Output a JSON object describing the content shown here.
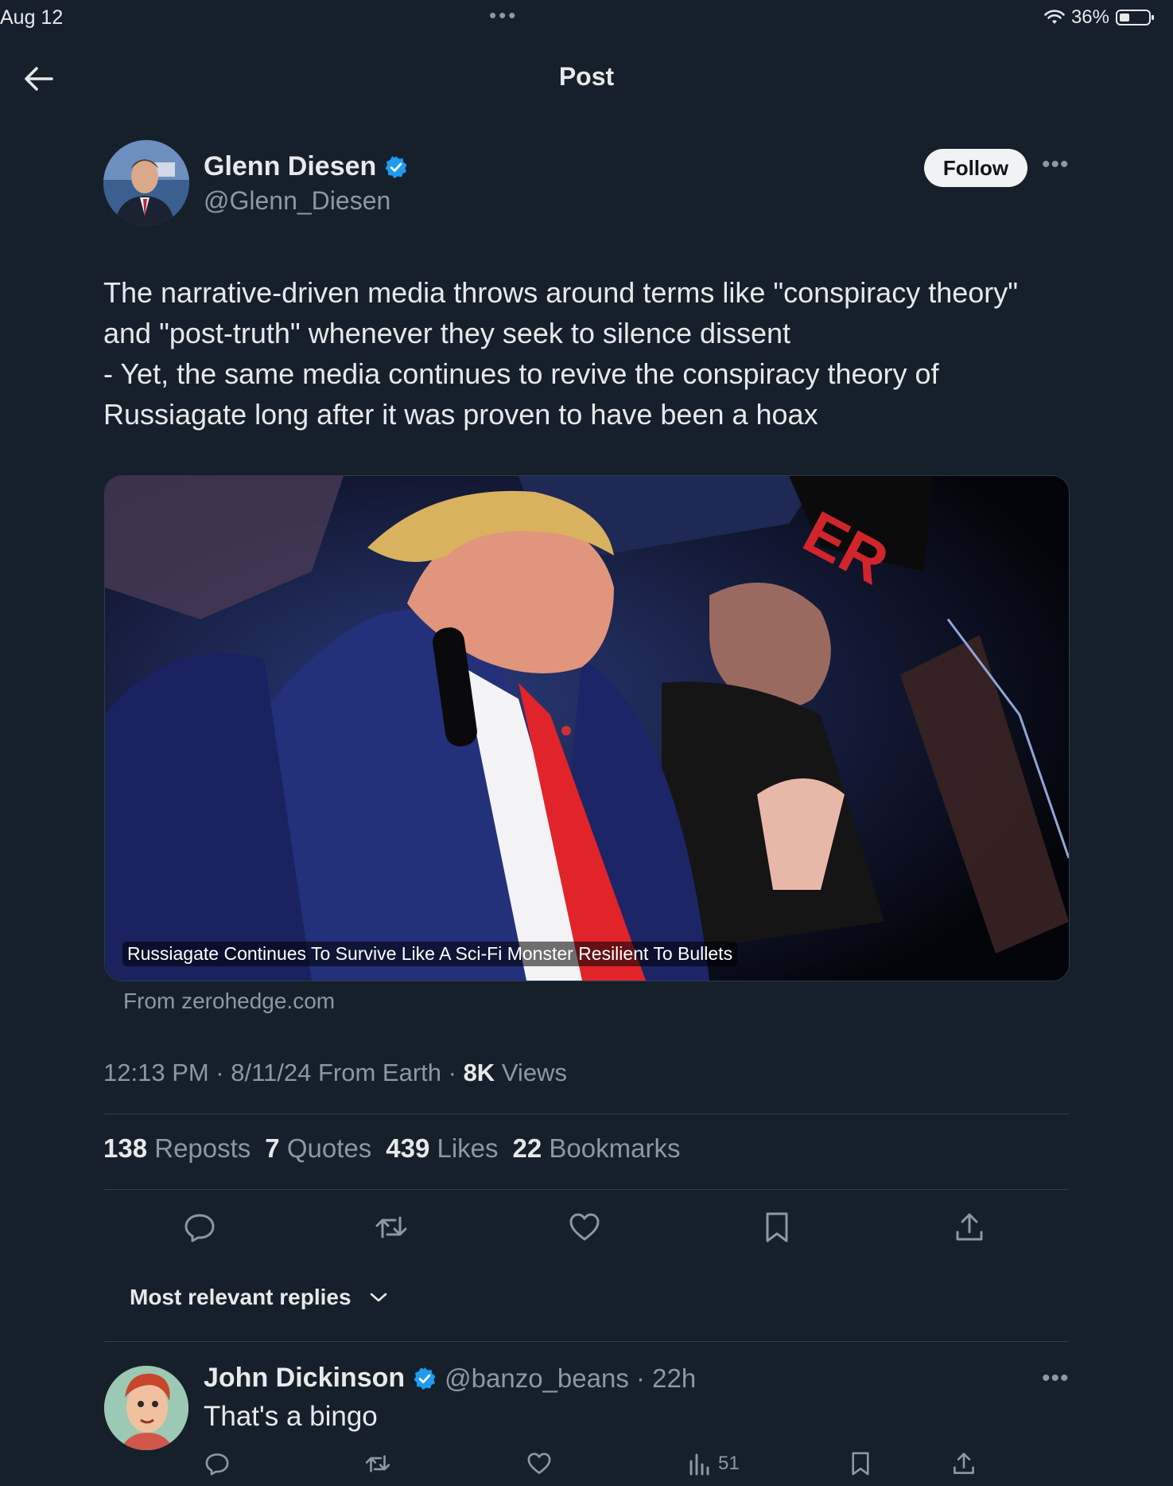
{
  "status_bar": {
    "date": "Aug 12",
    "battery": "36%"
  },
  "header": {
    "title": "Post"
  },
  "author": {
    "name": "Glenn Diesen",
    "handle": "@Glenn_Diesen",
    "follow_label": "Follow"
  },
  "post": {
    "text": "The narrative-driven media throws around terms like \"conspiracy theory\" and \"post-truth\" whenever they seek to silence dissent\n- Yet, the same media continues to revive the conspiracy theory of Russiagate long after it was proven to have been a hoax",
    "card": {
      "caption": "Russiagate Continues To Survive Like A Sci-Fi Monster Resilient To Bullets",
      "source": "From zerohedge.com"
    },
    "meta": {
      "time": "12:13 PM · 8/11/24 From Earth · ",
      "views_count": "8K",
      "views_label": " Views"
    },
    "stats": {
      "reposts_count": "138",
      "reposts_label": "Reposts",
      "quotes_count": "7",
      "quotes_label": "Quotes",
      "likes_count": "439",
      "likes_label": "Likes",
      "bookmarks_count": "22",
      "bookmarks_label": "Bookmarks"
    }
  },
  "replies_filter": {
    "label": "Most relevant replies"
  },
  "reply": {
    "name": "John Dickinson",
    "handle_time": "@banzo_beans · 22h",
    "text": "That's a bingo",
    "views": "51"
  },
  "colors": {
    "background": "#16202b",
    "verified": "#1d9bf0",
    "muted": "#8b98a5"
  },
  "icons": [
    "back-arrow-icon",
    "verified-badge-icon",
    "more-icon",
    "reply-icon",
    "repost-icon",
    "like-icon",
    "bookmark-icon",
    "share-icon",
    "views-icon",
    "chevron-down-icon"
  ]
}
